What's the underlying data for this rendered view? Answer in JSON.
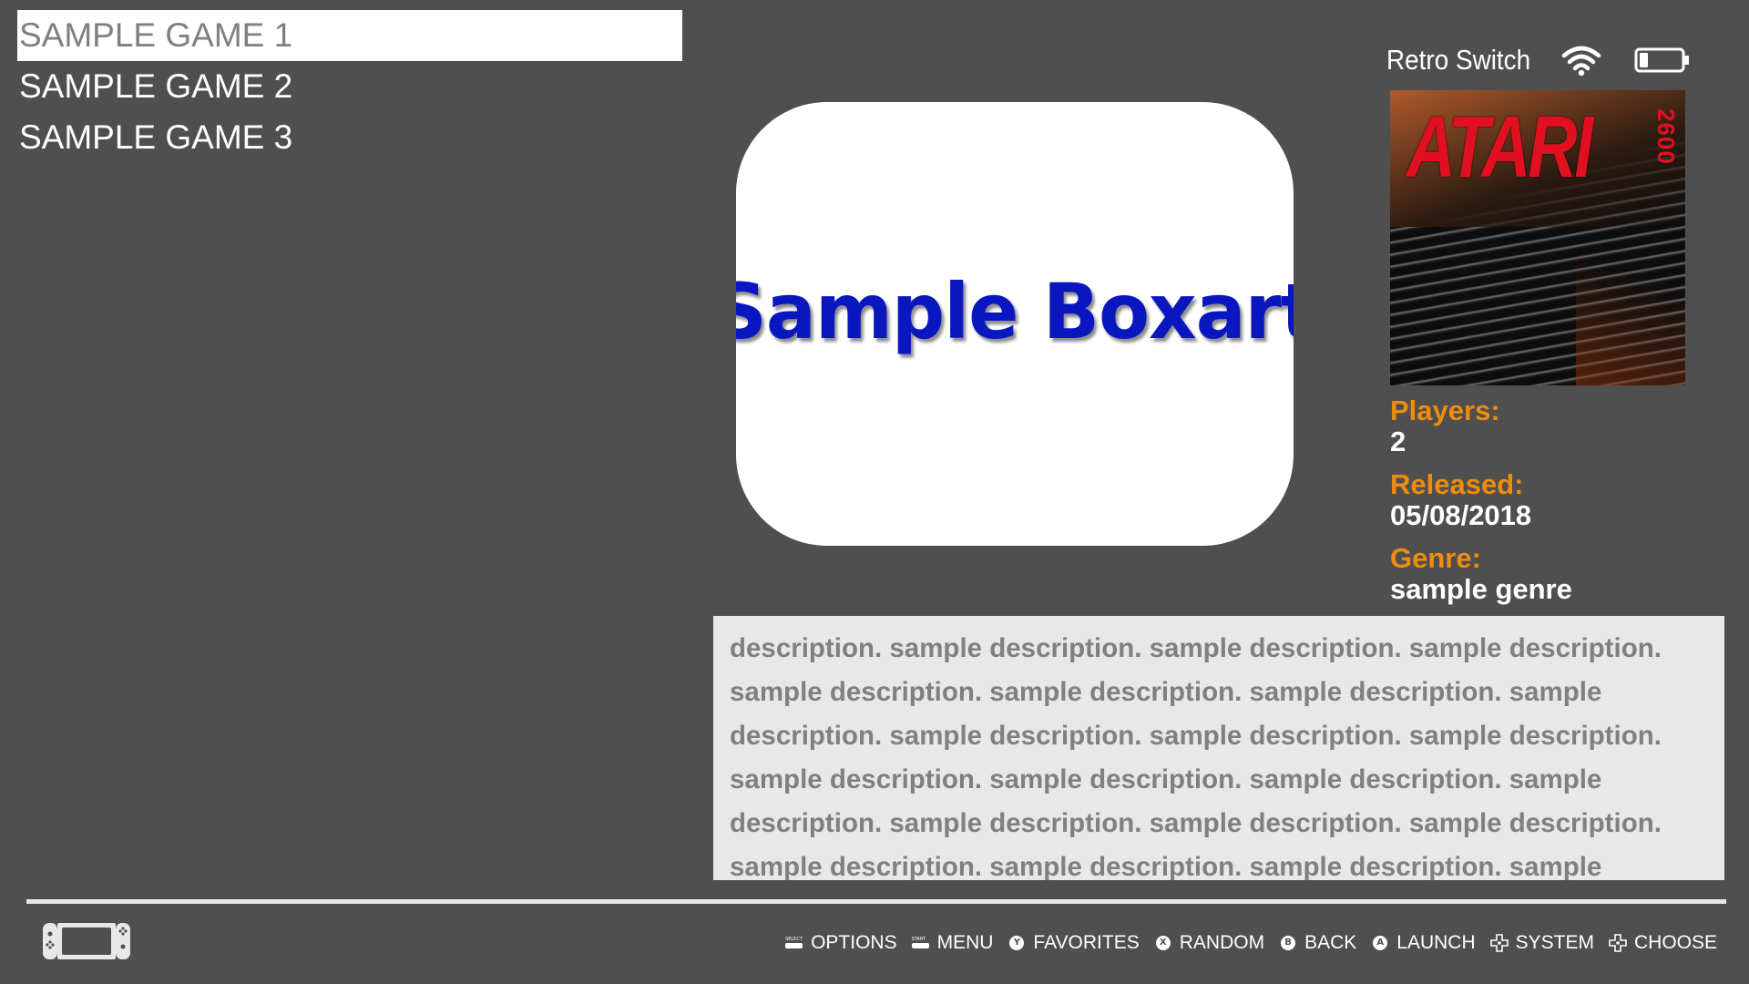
{
  "games": [
    {
      "title": "SAMPLE GAME 1",
      "selected": true
    },
    {
      "title": "SAMPLE GAME 2",
      "selected": false
    },
    {
      "title": "SAMPLE GAME 3",
      "selected": false
    }
  ],
  "boxart": {
    "text": "Sample Boxart"
  },
  "status": {
    "system_name": "Retro Switch",
    "wifi_icon": "wifi-icon",
    "battery_icon": "battery-low-icon",
    "battery_level": 0.2
  },
  "system_logo": {
    "word": "ATARI",
    "model": "2600"
  },
  "metadata": {
    "players_label": "Players:",
    "players_value": "2",
    "released_label": "Released:",
    "released_value": "05/08/2018",
    "genre_label": "Genre:",
    "genre_value": "sample genre"
  },
  "description": "description. sample description. sample description. sample description. sample description. sample description. sample description. sample description. sample description. sample description. sample description. sample description. sample description. sample description. sample description. sample description. sample description. sample description. sample description. sample description. sample description. sample description. sample description. sample description.",
  "help": [
    {
      "glyph": "select",
      "glyph_text": "SELECT",
      "label": "OPTIONS"
    },
    {
      "glyph": "start",
      "glyph_text": "START",
      "label": "MENU"
    },
    {
      "glyph": "circle",
      "glyph_text": "Y",
      "label": "FAVORITES"
    },
    {
      "glyph": "circle",
      "glyph_text": "X",
      "label": "RANDOM"
    },
    {
      "glyph": "circle",
      "glyph_text": "B",
      "label": "BACK"
    },
    {
      "glyph": "circle",
      "glyph_text": "A",
      "label": "LAUNCH"
    },
    {
      "glyph": "dpad",
      "glyph_text": "",
      "label": "SYSTEM"
    },
    {
      "glyph": "dpad",
      "glyph_text": "",
      "label": "CHOOSE"
    }
  ],
  "colors": {
    "background": "#4f4f4f",
    "selection": "#ffffff",
    "label_accent": "#f08c0c",
    "boxart_text": "#0a17c0",
    "description_bg": "#e8e8e8",
    "description_text": "#808080"
  }
}
